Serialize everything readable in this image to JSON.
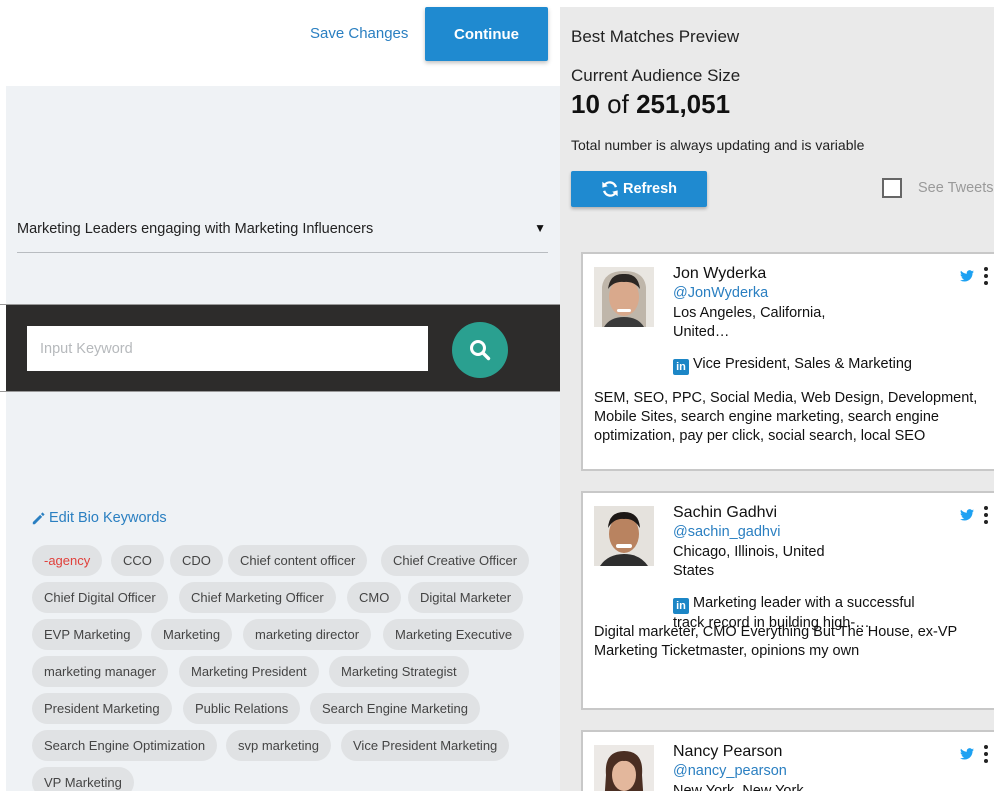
{
  "header": {
    "save_label": "Save Changes",
    "continue_label": "Continue"
  },
  "segment": {
    "selected": "Marketing Leaders engaging with Marketing Influencers",
    "arrow": "▼"
  },
  "search": {
    "placeholder": "Input Keyword"
  },
  "bio_keywords": {
    "edit_label": "Edit Bio Keywords",
    "tags": [
      "-agency",
      "CCO",
      "CDO",
      "Chief content officer",
      "Chief Creative Officer",
      "Chief Digital Officer",
      "Chief Marketing Officer",
      "CMO",
      "Digital Marketer",
      "EVP Marketing",
      "Marketing",
      "marketing director",
      "Marketing Executive",
      "marketing manager",
      "Marketing President",
      "Marketing Strategist",
      "President Marketing",
      "Public Relations",
      "Search Engine Marketing",
      "Search Engine Optimization",
      "svp marketing",
      "Vice President Marketing",
      "VP Marketing"
    ]
  },
  "preview": {
    "title": "Best Matches Preview",
    "audience_label": "Current Audience Size",
    "audience_shown": "10",
    "audience_of": "of",
    "audience_total": "251,051",
    "note": "Total number is always updating and is variable",
    "refresh_label": "Refresh",
    "see_tweets_label": "See Tweets",
    "see_tweets_checked": false
  },
  "matches": [
    {
      "name": "Jon Wyderka",
      "handle": "@JonWyderka",
      "location": "Los Angeles, California, United…",
      "linkedin_title": "Vice President, Sales & Marketing",
      "bio": "SEM, SEO, PPC, Social Media, Web Design, Development, Mobile Sites, search engine marketing, search engine optimization, pay per click, social search, local SEO"
    },
    {
      "name": "Sachin Gadhvi",
      "handle": "@sachin_gadhvi",
      "location": "Chicago, Illinois, United States",
      "linkedin_title": "Marketing leader with a successful track record in building high-…",
      "bio": "Digital marketer, CMO Everything But The House, ex-VP Marketing Ticketmaster, opinions my own"
    },
    {
      "name": "Nancy Pearson",
      "handle": "@nancy_pearson",
      "location": "New York, New York",
      "linkedin_title": "",
      "bio": ""
    }
  ],
  "colors": {
    "primary_blue": "#1f8ad0",
    "link_blue": "#2a7fc1",
    "search_teal": "#2aa090",
    "negative_tag": "#e0403b",
    "twitter_blue": "#1da1f2",
    "linkedin_blue": "#1c86c6"
  }
}
